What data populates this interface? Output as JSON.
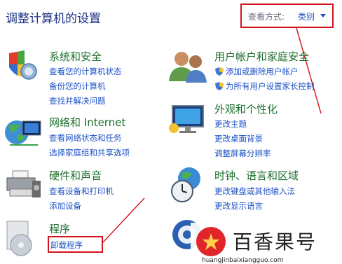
{
  "page": {
    "title": "调整计算机的设置",
    "view_by_label": "查看方式:",
    "view_by_value": "类别"
  },
  "left": [
    {
      "title": "系统和安全",
      "links": [
        "查看您的计算机状态",
        "备份您的计算机",
        "查找并解决问题"
      ]
    },
    {
      "title": "网络和 Internet",
      "links": [
        "查看网络状态和任务",
        "选择家庭组和共享选项"
      ]
    },
    {
      "title": "硬件和声音",
      "links": [
        "查看设备和打印机",
        "添加设备"
      ]
    },
    {
      "title": "程序",
      "links": [
        "卸载程序"
      ]
    }
  ],
  "right": [
    {
      "title": "用户帐户和家庭安全",
      "links": [
        "添加或删除用户帐户",
        "为所有用户设置家长控制"
      ]
    },
    {
      "title": "外观和个性化",
      "links": [
        "更改主题",
        "更改桌面背景",
        "调整屏幕分辨率"
      ]
    },
    {
      "title": "时钟、语言和区域",
      "links": [
        "更改键盘或其他输入法",
        "更改显示语言"
      ]
    }
  ],
  "watermark": {
    "brand": "百香果号",
    "url": "huangjinbaixiangguo.com"
  },
  "colors": {
    "accent_red": "#d4141c",
    "link_blue": "#1b50c6",
    "category_green": "#1c6e2c"
  }
}
